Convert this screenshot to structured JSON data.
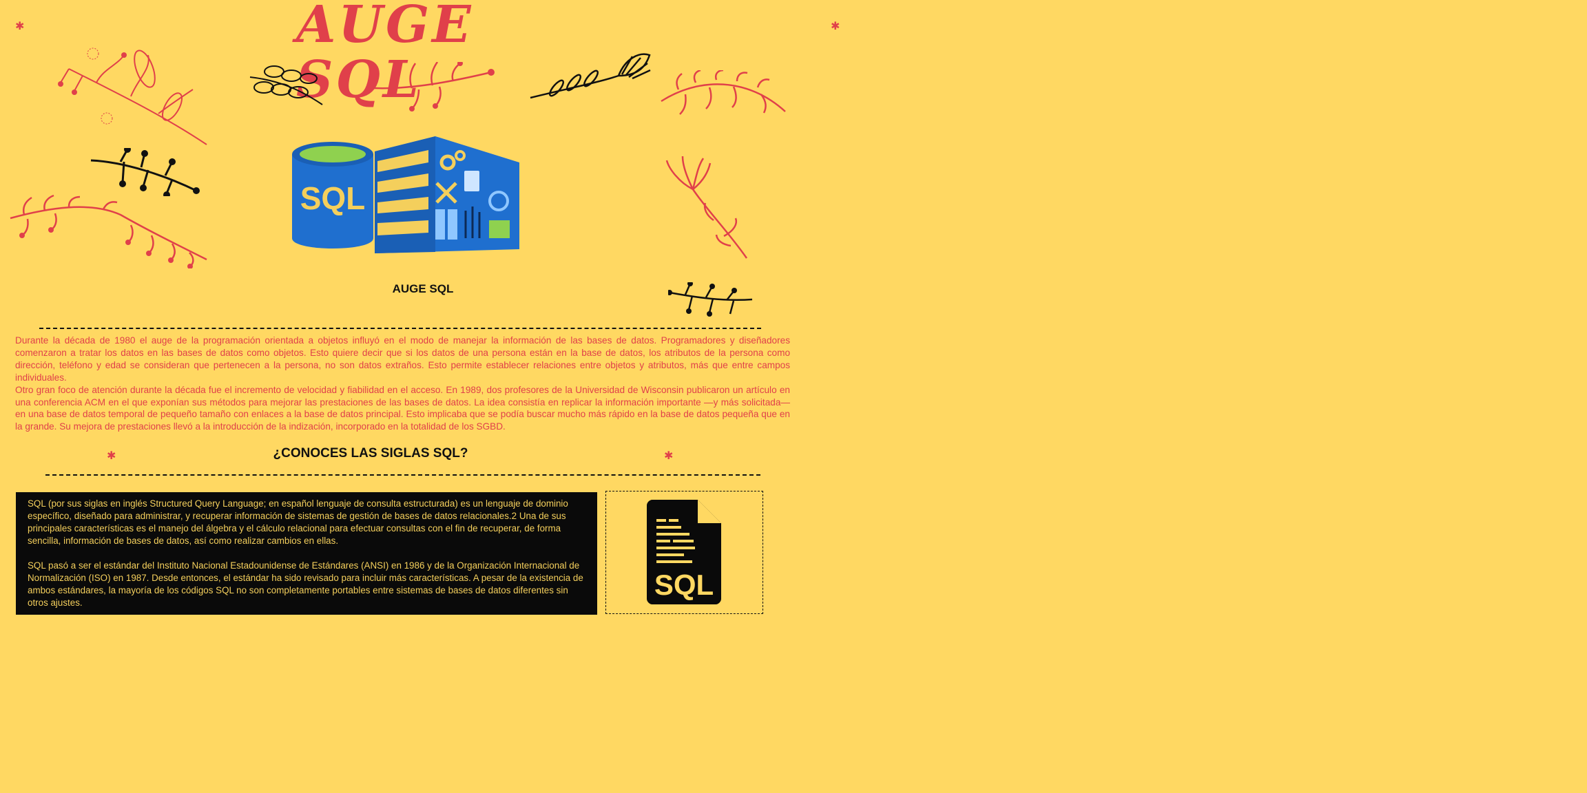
{
  "header": {
    "hero_title": "AUGE SQL",
    "logo_label": "SQL",
    "subtitle": "AUGE SQL"
  },
  "intro": {
    "paragraphs": [
      "Durante la década de 1980 el auge de la programación orientada a objetos influyó en el modo de manejar la información de las bases de datos. Programadores y diseñadores comenzaron a tratar los datos en las bases de datos como objetos. Esto quiere decir que si los datos de una persona están en la base de datos, los atributos de la persona como dirección, teléfono y edad se consideran que pertenecen a la persona, no son datos extraños. Esto permite establecer relaciones entre objetos y atributos, más que entre campos individuales.",
      "Otro gran foco de atención durante la década fue el incremento de velocidad y fiabilidad en el acceso. En 1989, dos profesores de la Universidad de Wisconsin publicaron un artículo en una conferencia ACM en el que exponían sus métodos para mejorar las prestaciones de las bases de datos. La idea consistía en replicar la información importante —y más solicitada— en una base de datos temporal de pequeño tamaño con enlaces a la base de datos principal. Esto implicaba que se podía buscar mucho más rápido en la base de datos pequeña que en la grande. Su mejora de prestaciones llevó a la introducción de la indización, incorporado en la totalidad de los SGBD."
    ]
  },
  "siglas": {
    "title": "¿CONOCES LAS SIGLAS SQL?",
    "paragraphs": [
      "SQL (por sus siglas en inglés Structured Query Language; en español lenguaje de consulta estructurada) es un lenguaje de dominio específico, diseñado para administrar, y recuperar información de sistemas de gestión de bases de datos relacionales.2 Una de sus principales características es el manejo del álgebra y el cálculo relacional para efectuar consultas con el fin de recuperar, de forma sencilla, información de bases de datos, así como realizar cambios en ellas.",
      "SQL pasó a ser el estándar del Instituto Nacional Estadounidense de Estándares (ANSI) en 1986 y de la Organización Internacional de Normalización (ISO) en 1987. Desde entonces, el estándar ha sido revisado para incluir más características. A pesar de la existencia de ambos estándares, la mayoría de los códigos SQL no son completamente portables entre sistemas de bases de datos diferentes sin otros ajustes."
    ],
    "file_icon_label": "SQL"
  },
  "icons": {
    "decorations": "floral-branch-icon",
    "logo": "database-server-icon",
    "file": "sql-file-icon",
    "star": "asterisk-icon"
  },
  "colors": {
    "background": "#ffd862",
    "accent_red": "#e0404a",
    "text_dark": "#111111",
    "box_text": "#f4cf5c",
    "logo_blue": "#1f6fcf",
    "logo_yellow": "#f4cf5c",
    "logo_green": "#8fd14f"
  }
}
